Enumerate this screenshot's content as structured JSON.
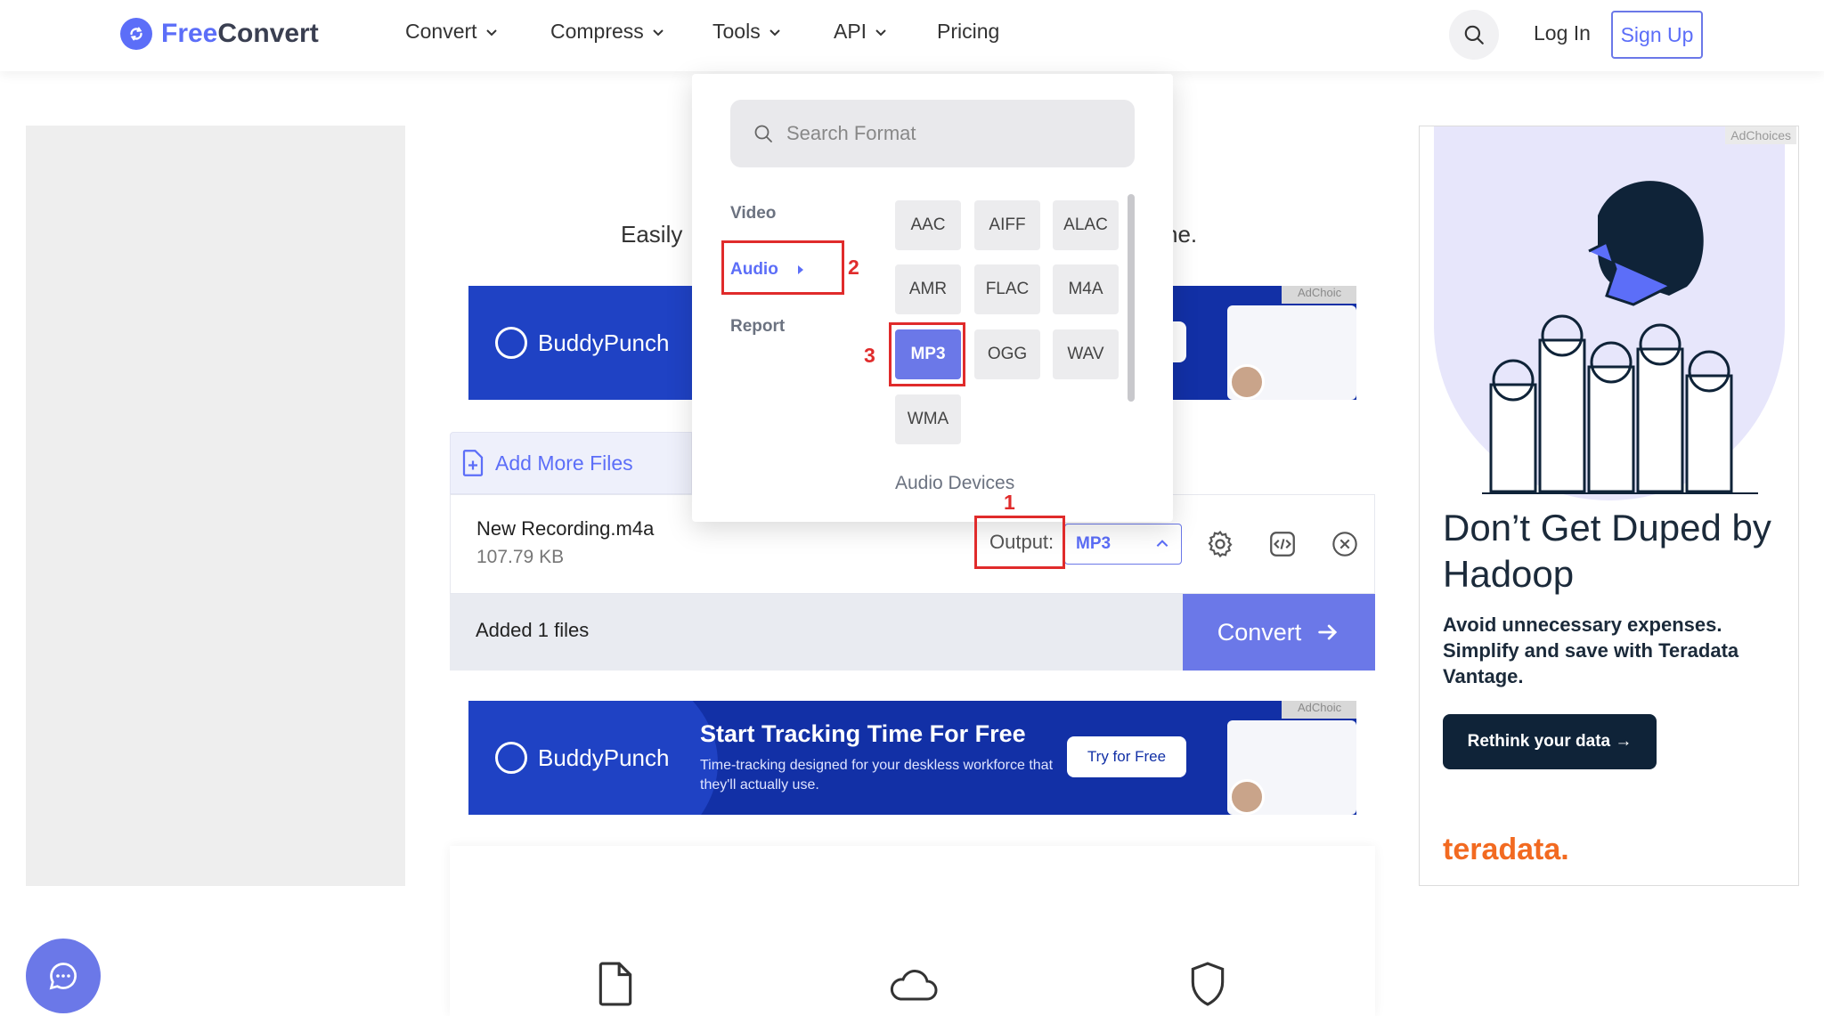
{
  "brand": {
    "free": "Free",
    "convert": "Convert"
  },
  "nav": [
    {
      "label": "Convert"
    },
    {
      "label": "Compress"
    },
    {
      "label": "Tools"
    },
    {
      "label": "API"
    },
    {
      "label": "Pricing"
    }
  ],
  "header": {
    "login": "Log In",
    "signup": "Sign Up"
  },
  "tagline": {
    "left": "Easily",
    "right": "ne."
  },
  "banner": {
    "brand": "BuddyPunch",
    "title": "Start Tracking Time For Free",
    "subtitle": "Time-tracking designed for your deskless workforce that they'll actually use.",
    "cta": "Try for Free",
    "adchoices": "AdChoic"
  },
  "files": {
    "add_more": "Add More Files",
    "file_name": "New Recording.m4a",
    "file_size": "107.79 KB",
    "output_label": "Output:",
    "output_value": "MP3",
    "added_count": "Added 1 files",
    "convert": "Convert"
  },
  "dropdown": {
    "search_placeholder": "Search Format",
    "categories": [
      "Video",
      "Audio",
      "Report"
    ],
    "formats": [
      "AAC",
      "AIFF",
      "ALAC",
      "AMR",
      "FLAC",
      "M4A",
      "MP3",
      "OGG",
      "WAV",
      "WMA"
    ],
    "selected": "MP3",
    "audio_devices": "Audio Devices"
  },
  "annotations": [
    "1",
    "2",
    "3"
  ],
  "right_ad": {
    "adchoices": "AdChoices",
    "headline": "Don’t Get Duped by Hadoop",
    "body": "Avoid unnecessary expenses. Simplify and save with Teradata Vantage.",
    "cta": "Rethink your data →",
    "brand": "teradata."
  },
  "colors": {
    "accent": "#6b78e8",
    "brand": "#5c6ef8",
    "annotation": "#e02b2b",
    "banner": "#1230a6"
  }
}
